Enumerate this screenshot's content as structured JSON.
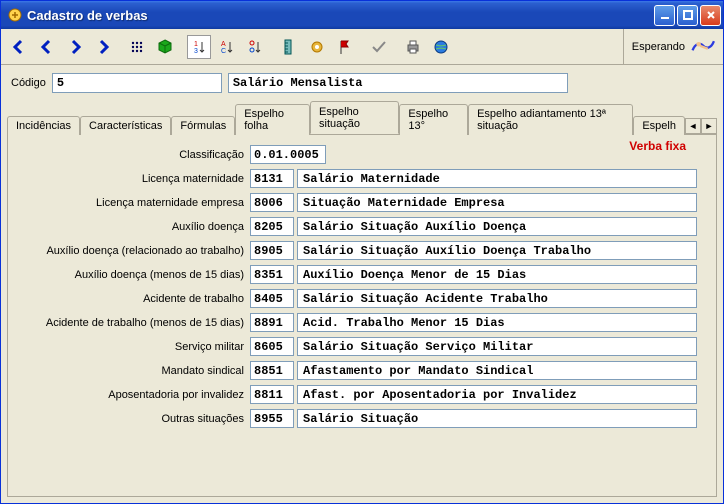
{
  "window": {
    "title": "Cadastro de verbas"
  },
  "toolbar": {
    "status": "Esperando"
  },
  "form": {
    "code_label": "Código",
    "code_value": "5",
    "desc_value": "Salário Mensalista"
  },
  "tabs": {
    "items": [
      {
        "label": "Incidências"
      },
      {
        "label": "Características"
      },
      {
        "label": "Fórmulas"
      },
      {
        "label": "Espelho folha"
      },
      {
        "label": "Espelho situação"
      },
      {
        "label": "Espelho 13°"
      },
      {
        "label": "Espelho adiantamento 13ª situação"
      },
      {
        "label": "Espelh"
      }
    ],
    "active_index": 4
  },
  "content": {
    "badge": "Verba fixa",
    "classification": {
      "label": "Classificação",
      "value": "0.01.0005"
    },
    "rows": [
      {
        "label": "Licença maternidade",
        "code": "8131",
        "desc": "Salário Maternidade"
      },
      {
        "label": "Licença maternidade empresa",
        "code": "8006",
        "desc": "Situação Maternidade Empresa"
      },
      {
        "label": "Auxílio doença",
        "code": "8205",
        "desc": "Salário Situação Auxílio Doença"
      },
      {
        "label": "Auxílio doença (relacionado ao trabalho)",
        "code": "8905",
        "desc": "Salário Situação Auxílio Doença Trabalho"
      },
      {
        "label": "Auxílio doença (menos de 15 dias)",
        "code": "8351",
        "desc": "Auxílio Doença Menor de 15 Dias"
      },
      {
        "label": "Acidente de trabalho",
        "code": "8405",
        "desc": "Salário Situação Acidente Trabalho"
      },
      {
        "label": "Acidente de trabalho (menos de 15 dias)",
        "code": "8891",
        "desc": "Acid. Trabalho Menor 15 Dias"
      },
      {
        "label": "Serviço militar",
        "code": "8605",
        "desc": "Salário Situação Serviço Militar"
      },
      {
        "label": "Mandato sindical",
        "code": "8851",
        "desc": "Afastamento por Mandato Sindical"
      },
      {
        "label": "Aposentadoria por invalidez",
        "code": "8811",
        "desc": "Afast. por Aposentadoria por Invalidez"
      },
      {
        "label": "Outras situações",
        "code": "8955",
        "desc": "Salário Situação"
      }
    ]
  }
}
